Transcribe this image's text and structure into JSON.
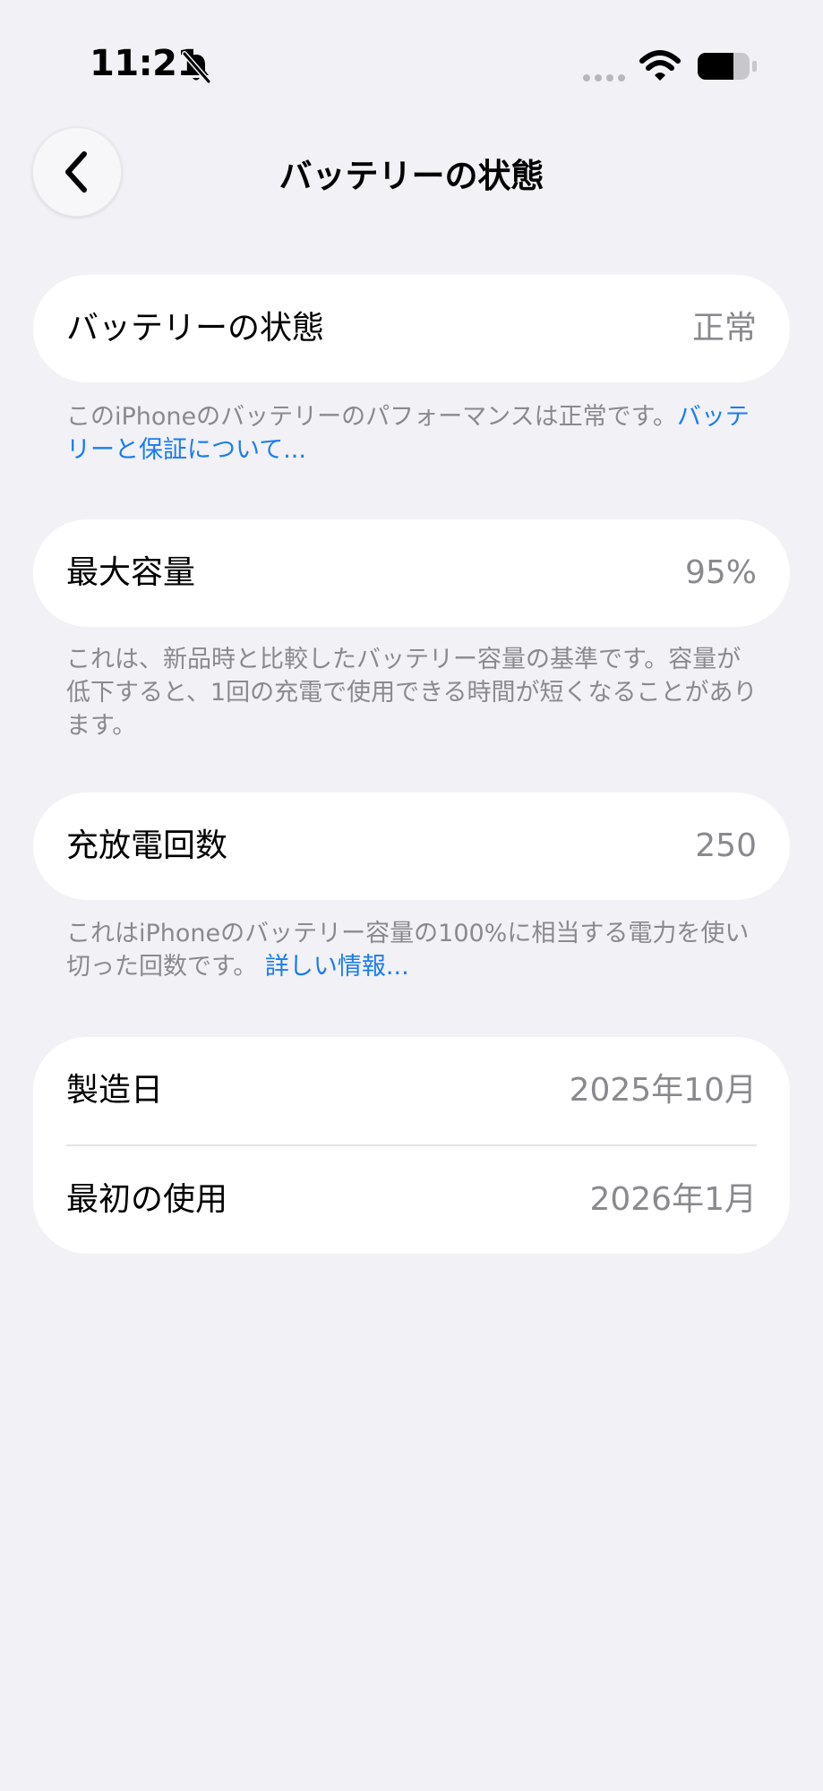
{
  "status_bar": {
    "time": "11:21",
    "icons": [
      "bell-slash-icon",
      "cellular-signal-icon",
      "wifi-icon",
      "battery-icon"
    ]
  },
  "header": {
    "back_icon": "chevron-left-icon",
    "title": "バッテリーの状態"
  },
  "battery_health": {
    "label": "バッテリーの状態",
    "value": "正常",
    "note": "このiPhoneのバッテリーのパフォーマンスは正常です。",
    "link": "バッテリーと保証について..."
  },
  "maximum_capacity": {
    "label": "最大容量",
    "value": "95%",
    "note": "これは、新品時と比較したバッテリー容量の基準です。容量が低下すると、1回の充電で使用できる時間が短くなることがあります。"
  },
  "cycle_count": {
    "label": "充放電回数",
    "value": "250",
    "note": "これはiPhoneのバッテリー容量の100%に相当する電力を使い切った回数です。",
    "link": "詳しい情報..."
  },
  "dates": {
    "manufacture_label": "製造日",
    "manufacture_value": "2025年10月",
    "first_use_label": "最初の使用",
    "first_use_value": "2026年1月"
  },
  "colors": {
    "background": "#f1f1f6",
    "card": "#ffffff",
    "secondary_text": "#8a8a8e",
    "link": "#1a7cf0"
  }
}
